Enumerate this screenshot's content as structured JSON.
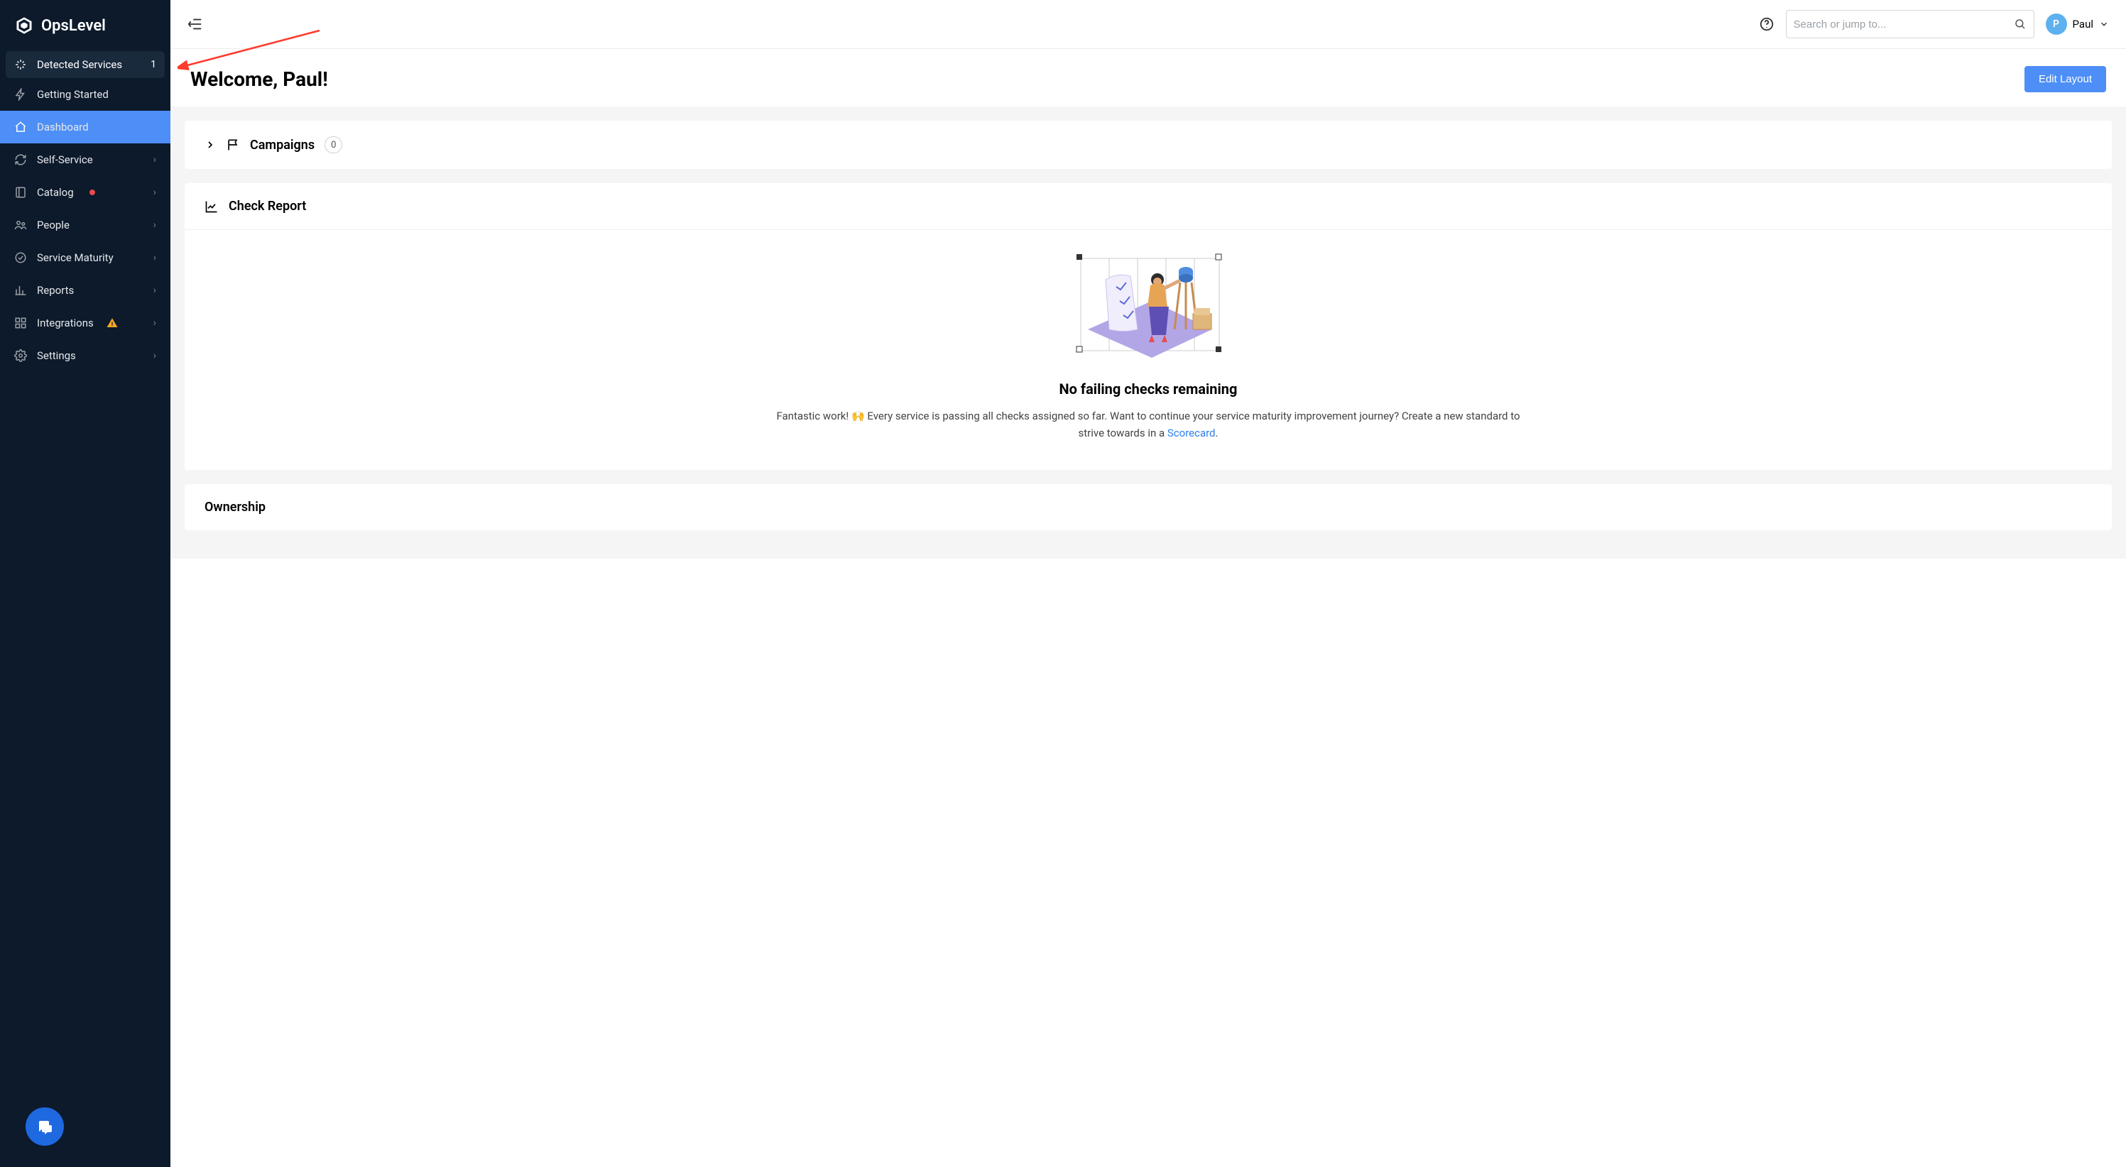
{
  "brand": {
    "name": "OpsLevel"
  },
  "sidebar": {
    "items": [
      {
        "icon": "sparkle-icon",
        "label": "Detected Services",
        "badge": "1",
        "highlighted": true
      },
      {
        "icon": "lightning-icon",
        "label": "Getting Started"
      },
      {
        "icon": "home-icon",
        "label": "Dashboard",
        "active": true
      },
      {
        "icon": "refresh-icon",
        "label": "Self-Service",
        "expandable": true
      },
      {
        "icon": "catalog-icon",
        "label": "Catalog",
        "dot": true,
        "expandable": true
      },
      {
        "icon": "people-icon",
        "label": "People",
        "expandable": true
      },
      {
        "icon": "check-circle-icon",
        "label": "Service Maturity",
        "expandable": true
      },
      {
        "icon": "bar-chart-icon",
        "label": "Reports",
        "expandable": true
      },
      {
        "icon": "grid-icon",
        "label": "Integrations",
        "warn": true,
        "expandable": true
      },
      {
        "icon": "gear-icon",
        "label": "Settings",
        "expandable": true
      }
    ]
  },
  "search": {
    "placeholder": "Search or jump to..."
  },
  "user": {
    "initial": "P",
    "name": "Paul"
  },
  "header": {
    "welcome": "Welcome, Paul!",
    "edit_layout_label": "Edit Layout"
  },
  "campaigns": {
    "title": "Campaigns",
    "count": "0"
  },
  "check_report": {
    "title": "Check Report",
    "heading": "No failing checks remaining",
    "text_pre": "Fantastic work! ",
    "text_mid": " Every service is passing all checks assigned so far. Want to continue your service maturity improvement journey? Create a new standard to strive towards in a ",
    "link_text": "Scorecard",
    "text_end": ".",
    "emoji": "🙌"
  },
  "ownership": {
    "title": "Ownership"
  }
}
